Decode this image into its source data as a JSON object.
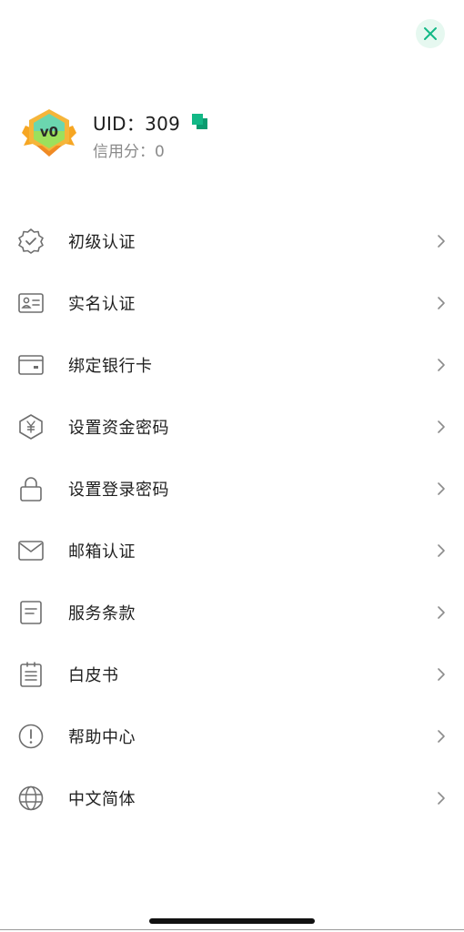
{
  "header": {
    "close_icon": "close-icon",
    "accent_color": "#12b886"
  },
  "profile": {
    "badge_label": "v0",
    "uid_text": "UID：309",
    "copy_icon": "copy-icon",
    "credit_text": "信用分：0"
  },
  "menu": {
    "items": [
      {
        "icon": "verified-badge-icon",
        "label": "初级认证"
      },
      {
        "icon": "id-card-icon",
        "label": "实名认证"
      },
      {
        "icon": "wallet-card-icon",
        "label": "绑定银行卡"
      },
      {
        "icon": "yuan-shield-icon",
        "label": "设置资金密码"
      },
      {
        "icon": "lock-icon",
        "label": "设置登录密码"
      },
      {
        "icon": "mail-icon",
        "label": "邮箱认证"
      },
      {
        "icon": "document-icon",
        "label": "服务条款"
      },
      {
        "icon": "clipboard-icon",
        "label": "白皮书"
      },
      {
        "icon": "help-icon",
        "label": "帮助中心"
      },
      {
        "icon": "globe-icon",
        "label": "中文简体"
      }
    ]
  }
}
